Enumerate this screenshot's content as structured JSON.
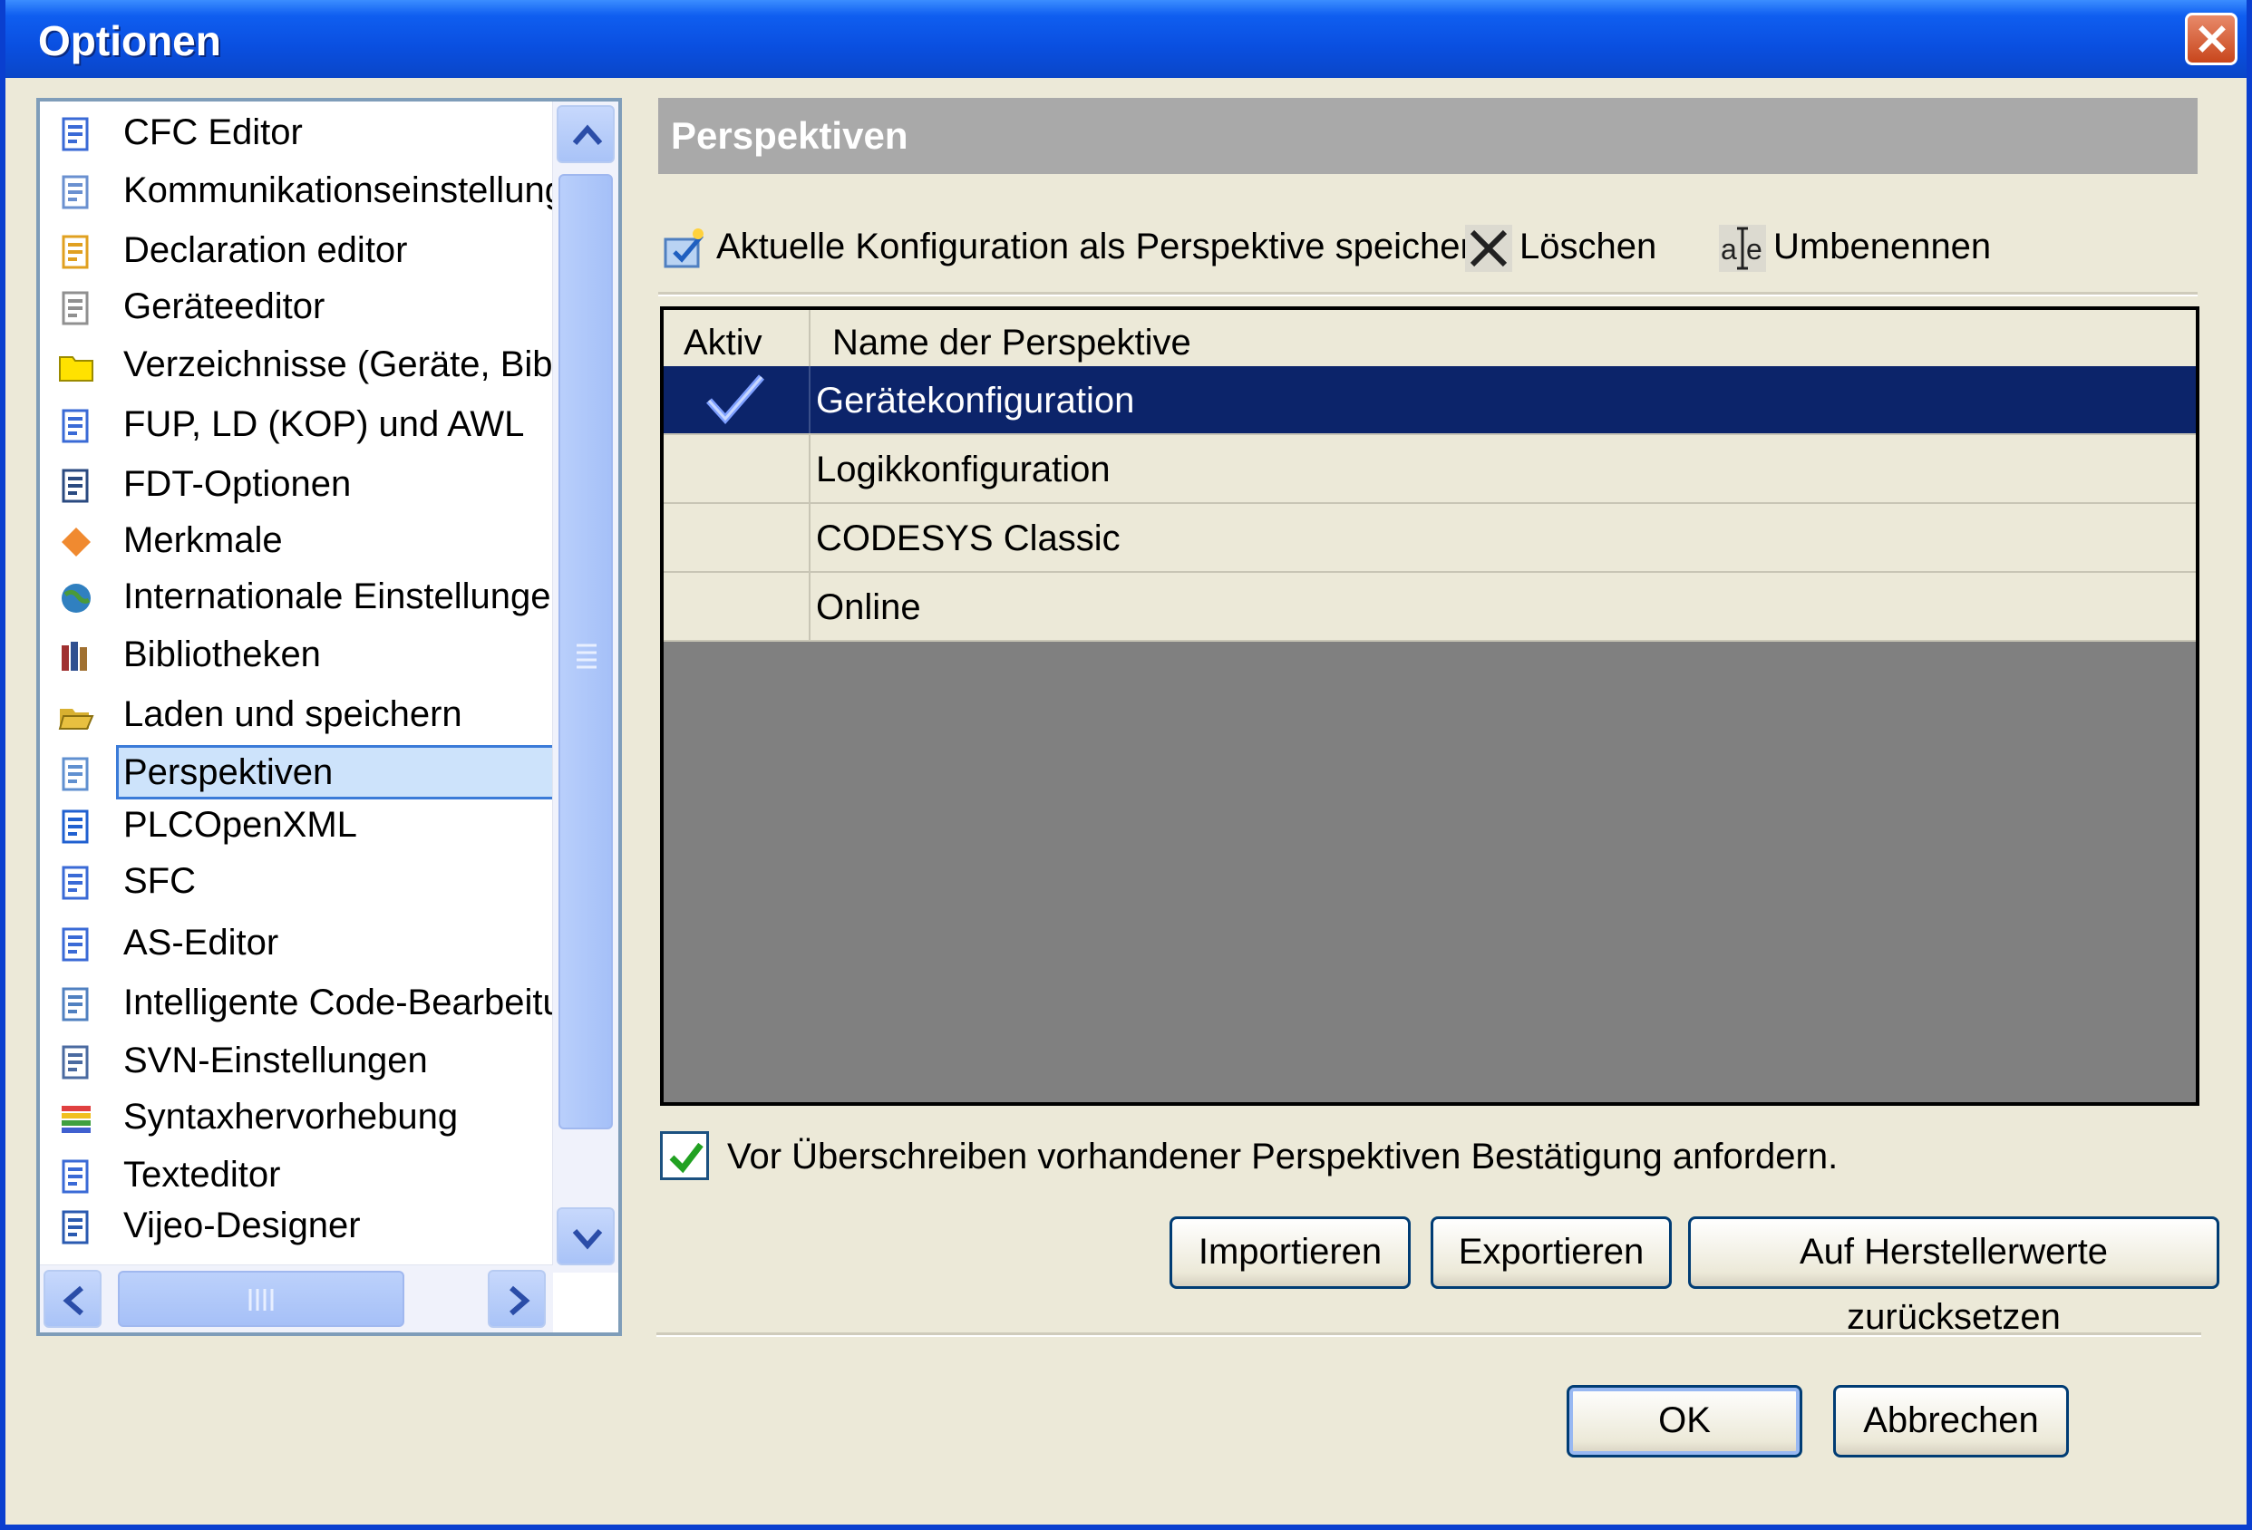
{
  "window": {
    "title": "Optionen"
  },
  "tree": {
    "items": [
      {
        "label": "CFC Editor",
        "icon": "cfc-editor-icon"
      },
      {
        "label": "Kommunikationseinstellungen",
        "icon": "communication-icon"
      },
      {
        "label": "Declaration editor",
        "icon": "declaration-editor-icon"
      },
      {
        "label": "Geräteeditor",
        "icon": "device-editor-icon"
      },
      {
        "label": "Verzeichnisse (Geräte, Bibliot",
        "icon": "folder-icon"
      },
      {
        "label": "FUP, LD (KOP) und AWL",
        "icon": "fbd-ld-il-icon"
      },
      {
        "label": "FDT-Optionen",
        "icon": "fdt-icon"
      },
      {
        "label": "Merkmale",
        "icon": "diamond-icon"
      },
      {
        "label": "Internationale Einstellungen",
        "icon": "globe-icon"
      },
      {
        "label": "Bibliotheken",
        "icon": "books-icon"
      },
      {
        "label": "Laden und speichern",
        "icon": "open-folder-icon"
      },
      {
        "label": "Perspektiven",
        "icon": "perspectives-icon"
      },
      {
        "label": "PLCOpenXML",
        "icon": "plcopenxml-icon"
      },
      {
        "label": "SFC",
        "icon": "sfc-icon"
      },
      {
        "label": "AS-Editor",
        "icon": "as-editor-icon"
      },
      {
        "label": "Intelligente Code-Bearbeitung",
        "icon": "smart-coding-icon"
      },
      {
        "label": "SVN-Einstellungen",
        "icon": "svn-icon"
      },
      {
        "label": "Syntaxhervorhebung",
        "icon": "syntax-highlighting-icon"
      },
      {
        "label": "Texteditor",
        "icon": "text-editor-icon"
      },
      {
        "label": "Vijeo-Designer",
        "icon": "vijeo-designer-icon"
      }
    ],
    "selected_index": 11
  },
  "panel": {
    "header": "Perspektiven",
    "toolbar": {
      "save_label": "Aktuelle Konfiguration als Perspektive speichern",
      "delete_label": "Löschen",
      "rename_label": "Umbenennen"
    },
    "grid": {
      "col_active": "Aktiv",
      "col_name": "Name der Perspektive",
      "rows": [
        {
          "name": "Gerätekonfiguration",
          "active": true
        },
        {
          "name": "Logikkonfiguration",
          "active": false
        },
        {
          "name": "CODESYS Classic",
          "active": false
        },
        {
          "name": "Online",
          "active": false
        }
      ]
    },
    "confirm_overwrite": {
      "label": "Vor Überschreiben vorhandener Perspektiven Bestätigung anfordern.",
      "checked": true
    },
    "buttons": {
      "import": "Importieren",
      "export": "Exportieren",
      "reset": "Auf Herstellerwerte zurücksetzen"
    }
  },
  "footer": {
    "ok": "OK",
    "cancel": "Abbrechen"
  },
  "colors": {
    "selection": "#0c246a",
    "titlebar": "#0a4fe0"
  }
}
